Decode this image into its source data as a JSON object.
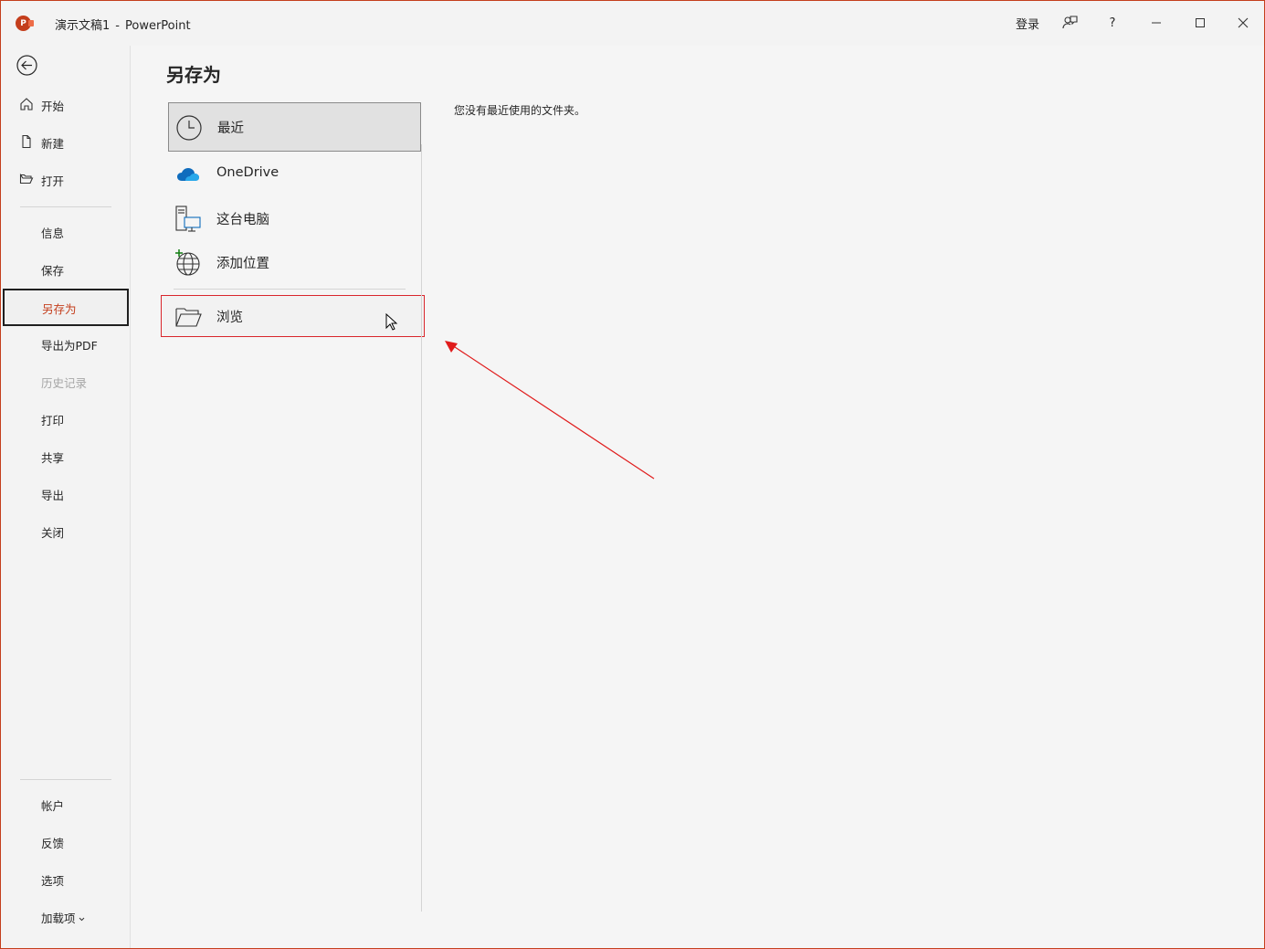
{
  "window": {
    "document_name": "演示文稿1",
    "separator": "-",
    "app_name": "PowerPoint",
    "logo_letter": "P",
    "accent_color": "#c43e1c"
  },
  "titlebar": {
    "signin_label": "登录",
    "help_label": "?"
  },
  "nav": {
    "top_items": [
      {
        "label": "开始",
        "icon": "home-icon"
      },
      {
        "label": "新建",
        "icon": "new-doc-icon"
      },
      {
        "label": "打开",
        "icon": "open-folder-icon"
      }
    ],
    "items": [
      {
        "label": "信息"
      },
      {
        "label": "保存"
      },
      {
        "label": "另存为",
        "selected": true
      },
      {
        "label": "导出为PDF"
      },
      {
        "label": "历史记录",
        "disabled": true
      },
      {
        "label": "打印"
      },
      {
        "label": "共享"
      },
      {
        "label": "导出"
      },
      {
        "label": "关闭"
      }
    ],
    "bottom_items": [
      {
        "label": "帐户"
      },
      {
        "label": "反馈"
      },
      {
        "label": "选项"
      },
      {
        "label": "加载项"
      }
    ]
  },
  "main": {
    "page_title": "另存为",
    "locations": [
      {
        "label": "最近",
        "icon": "clock-icon",
        "selected": true
      },
      {
        "label": "OneDrive",
        "icon": "onedrive-cloud-icon"
      },
      {
        "label": "这台电脑",
        "icon": "this-pc-icon"
      },
      {
        "label": "添加位置",
        "icon": "add-place-globe-icon"
      }
    ],
    "browse": {
      "label": "浏览",
      "icon": "browse-folder-icon"
    },
    "recent_message": "您没有最近使用的文件夹。"
  }
}
